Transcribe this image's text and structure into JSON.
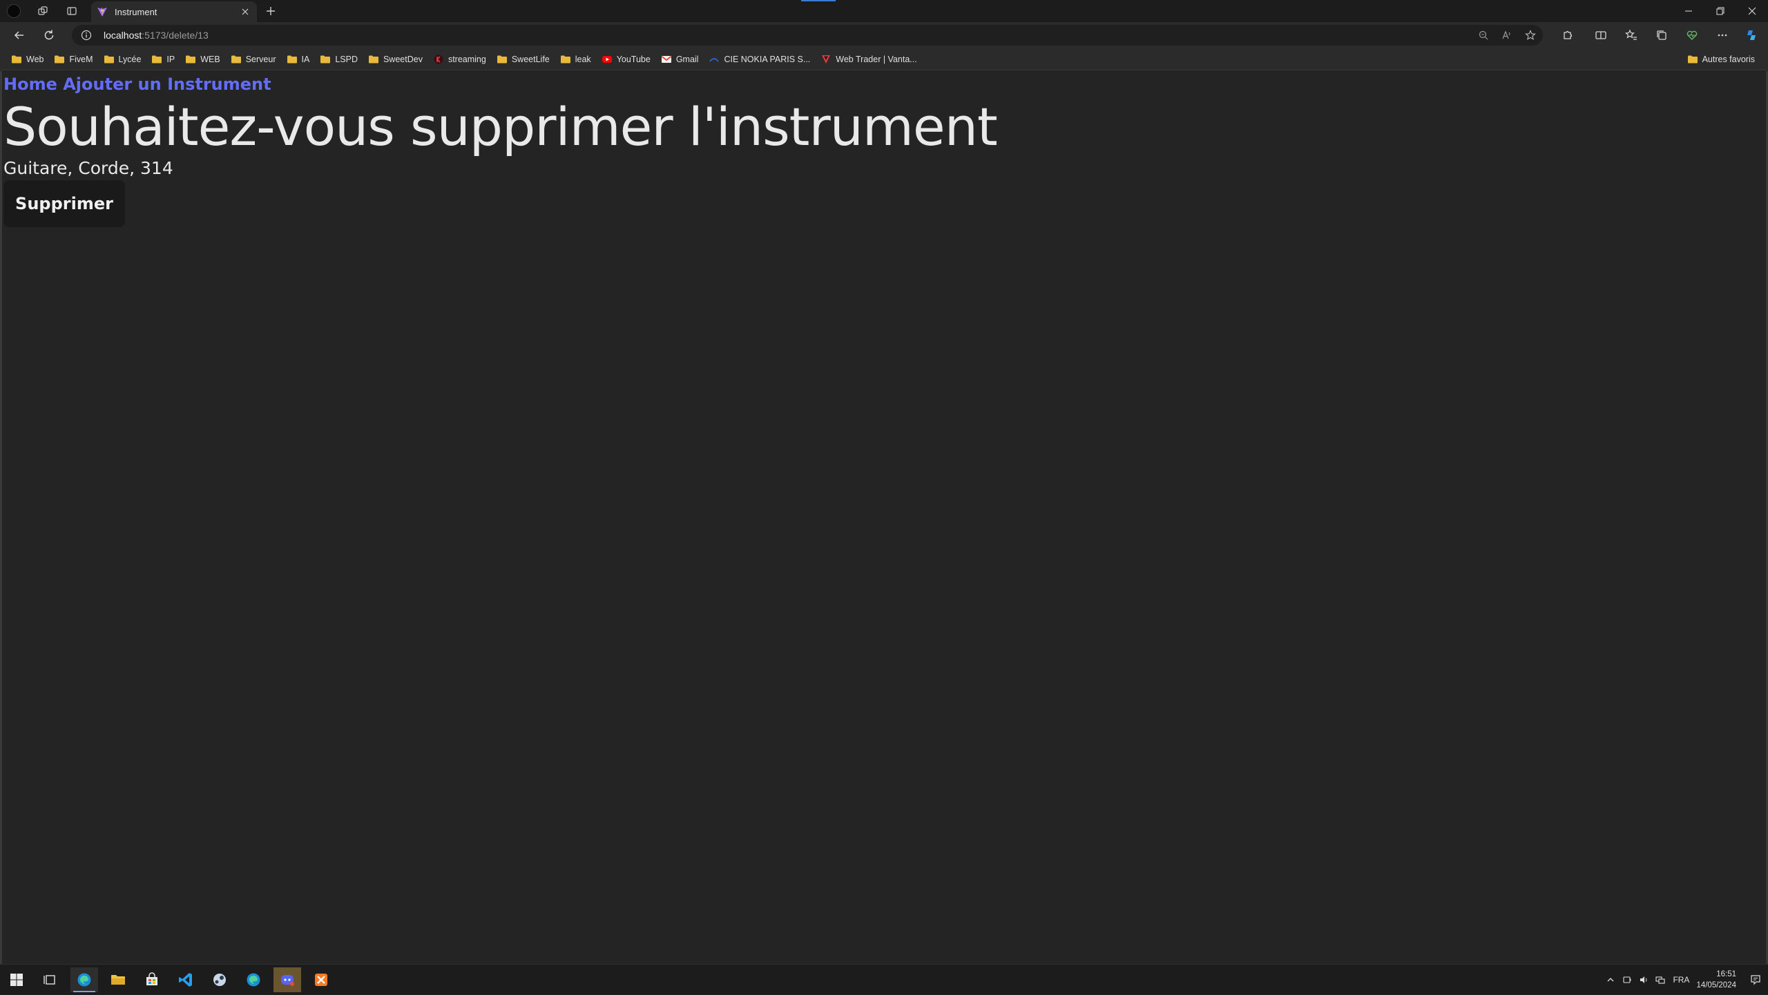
{
  "browser": {
    "tab_title": "Instrument",
    "url_host": "localhost",
    "url_path": ":5173/delete/13"
  },
  "favorites": [
    {
      "label": "Web",
      "icon": "folder-icon"
    },
    {
      "label": "FiveM",
      "icon": "folder-icon"
    },
    {
      "label": "Lycée",
      "icon": "folder-icon"
    },
    {
      "label": "IP",
      "icon": "folder-icon"
    },
    {
      "label": "WEB",
      "icon": "folder-icon"
    },
    {
      "label": "Serveur",
      "icon": "folder-icon"
    },
    {
      "label": "IA",
      "icon": "folder-icon"
    },
    {
      "label": "LSPD",
      "icon": "folder-icon"
    },
    {
      "label": "SweetDev",
      "icon": "folder-icon"
    },
    {
      "label": "streaming",
      "icon": "streaming-favicon"
    },
    {
      "label": "SweetLife",
      "icon": "folder-icon"
    },
    {
      "label": "leak",
      "icon": "folder-icon"
    },
    {
      "label": "YouTube",
      "icon": "youtube-icon"
    },
    {
      "label": "Gmail",
      "icon": "gmail-icon"
    },
    {
      "label": "CIE NOKIA PARIS S...",
      "icon": "nokia-favicon"
    },
    {
      "label": "Web Trader | Vanta...",
      "icon": "vantage-favicon"
    }
  ],
  "other_favorites_label": "Autres favoris",
  "page": {
    "nav_home": "Home",
    "nav_add": "Ajouter un Instrument",
    "title": "Souhaitez-vous supprimer l'instrument",
    "description": "Guitare, Corde, 314",
    "delete_label": "Supprimer"
  },
  "taskbar": {
    "language": "FRA",
    "time": "16:51",
    "date": "14/05/2024"
  },
  "colors": {
    "link": "#646cff",
    "page_bg": "#242424",
    "button_bg": "#1a1a1a",
    "folder": "#e8b93a"
  }
}
